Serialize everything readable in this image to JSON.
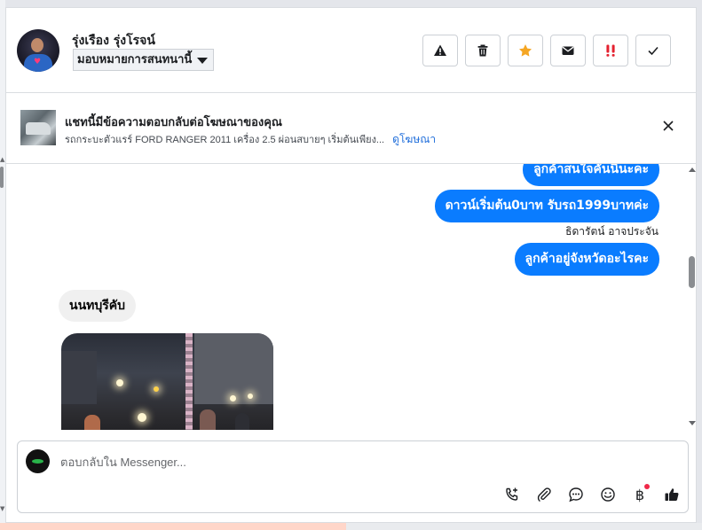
{
  "header": {
    "contact_name": "รุ่งเรือง รุ่งโรจน์",
    "assign_label": "มอบหมายการสนทนานี้",
    "actions": [
      {
        "name": "report-button",
        "icon": "warning-icon"
      },
      {
        "name": "delete-button",
        "icon": "trash-icon"
      },
      {
        "name": "star-button",
        "icon": "star-icon",
        "color": "#f5a623"
      },
      {
        "name": "mark-unread-button",
        "icon": "envelope-icon"
      },
      {
        "name": "follow-up-button",
        "icon": "double-exclamation-icon",
        "color": "#e4212f"
      },
      {
        "name": "mark-done-button",
        "icon": "check-icon"
      }
    ]
  },
  "ad_banner": {
    "title": "แชทนี้มีข้อความตอบกลับต่อโฆษณาของคุณ",
    "subtitle": "รถกระบะตัวแรร์ FORD RANGER 2011 เครื่อง 2.5 ผ่อนสบายๆ เริ่มต้นเพียง...",
    "link_label": "ดูโฆษณา"
  },
  "messages": [
    {
      "direction": "out",
      "text": "ลูกค้าสนใจคันนี้นะคะ"
    },
    {
      "direction": "out",
      "text": "ดาวน์เริ่มต้น0บาท รับรถ1999บาทค่ะ"
    },
    {
      "direction": "label",
      "text": "ธิดารัตน์ อาจประจัน"
    },
    {
      "direction": "out",
      "text": "ลูกค้าอยู่จังหวัดอะไรคะ"
    },
    {
      "direction": "in",
      "text": "นนทบุรีคับ"
    }
  ],
  "composer": {
    "placeholder": "ตอบกลับใน Messenger...",
    "tools": [
      "call-add-icon",
      "attachment-icon",
      "saved-replies-icon",
      "emoji-icon",
      "baht-payment-icon",
      "thumbs-up-icon"
    ],
    "baht_symbol": "฿"
  },
  "colors": {
    "accent": "#0a7cff",
    "link": "#216fdb",
    "notification_dot": "#f02849"
  }
}
